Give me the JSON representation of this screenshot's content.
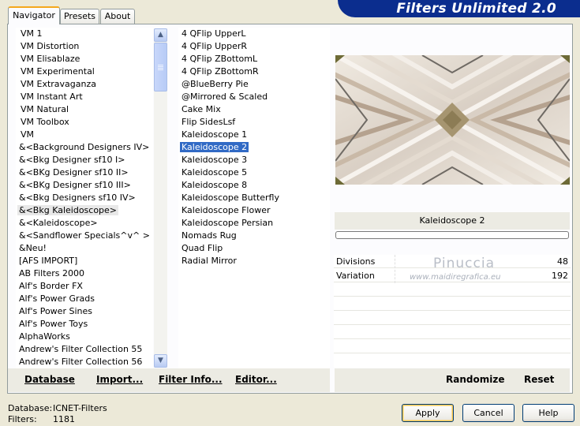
{
  "app": {
    "title": "Filters Unlimited 2.0"
  },
  "tabs": [
    {
      "label": "Navigator",
      "active": true
    },
    {
      "label": "Presets",
      "active": false
    },
    {
      "label": "About",
      "active": false
    }
  ],
  "categories": [
    "VM 1",
    "VM Distortion",
    "VM Elisablaze",
    "VM Experimental",
    "VM Extravaganza",
    "VM Instant Art",
    "VM Natural",
    "VM Toolbox",
    "VM",
    "&<Background Designers IV>",
    "&<Bkg Designer sf10 I>",
    "&<BKg Designer sf10 II>",
    "&<BKg Designer sf10 III>",
    "&<Bkg Designers sf10 IV>",
    "&<Bkg Kaleidoscope>",
    "&<Kaleidoscope>",
    "&<Sandflower Specials^v^ >",
    "&Neu!",
    "[AFS IMPORT]",
    "AB Filters 2000",
    "Alf's Border FX",
    "Alf's Power Grads",
    "Alf's Power Sines",
    "Alf's Power Toys",
    "AlphaWorks",
    "Andrew's Filter Collection 55",
    "Andrew's Filter Collection 56"
  ],
  "selected_category": "&<Bkg Kaleidoscope>",
  "filters": [
    "4 QFlip UpperL",
    "4 QFlip UpperR",
    "4 QFlip ZBottomL",
    "4 QFlip ZBottomR",
    "@BlueBerry Pie",
    "@Mirrored & Scaled",
    "Cake Mix",
    "Flip SidesLsf",
    "Kaleidoscope 1",
    "Kaleidoscope 2",
    "Kaleidoscope 3",
    "Kaleidoscope 5",
    "Kaleidoscope 8",
    "Kaleidoscope Butterfly",
    "Kaleidoscope Flower",
    "Kaleidoscope Persian",
    "Nomads Rug",
    "Quad Flip",
    "Radial Mirror"
  ],
  "selected_filter": "Kaleidoscope 2",
  "left_actions": {
    "database": "Database",
    "import": "Import...",
    "filter_info": "Filter Info...",
    "editor": "Editor..."
  },
  "right_actions": {
    "randomize": "Randomize",
    "reset": "Reset"
  },
  "current_filter_name": "Kaleidoscope 2",
  "params": [
    {
      "name": "Divisions",
      "value": "48"
    },
    {
      "name": "Variation",
      "value": "192"
    }
  ],
  "watermark": {
    "line1": "Pinuccia",
    "line2": "www.maidiregrafica.eu"
  },
  "status": {
    "database_label": "Database:",
    "database_value": "ICNET-Filters",
    "filters_label": "Filters:",
    "filters_value": "1181"
  },
  "buttons": {
    "apply": "Apply",
    "cancel": "Cancel",
    "help": "Help"
  },
  "colors": {
    "banner": "#0b2d8e",
    "selection": "#316ac5",
    "tab_accent": "#f4a81d"
  }
}
